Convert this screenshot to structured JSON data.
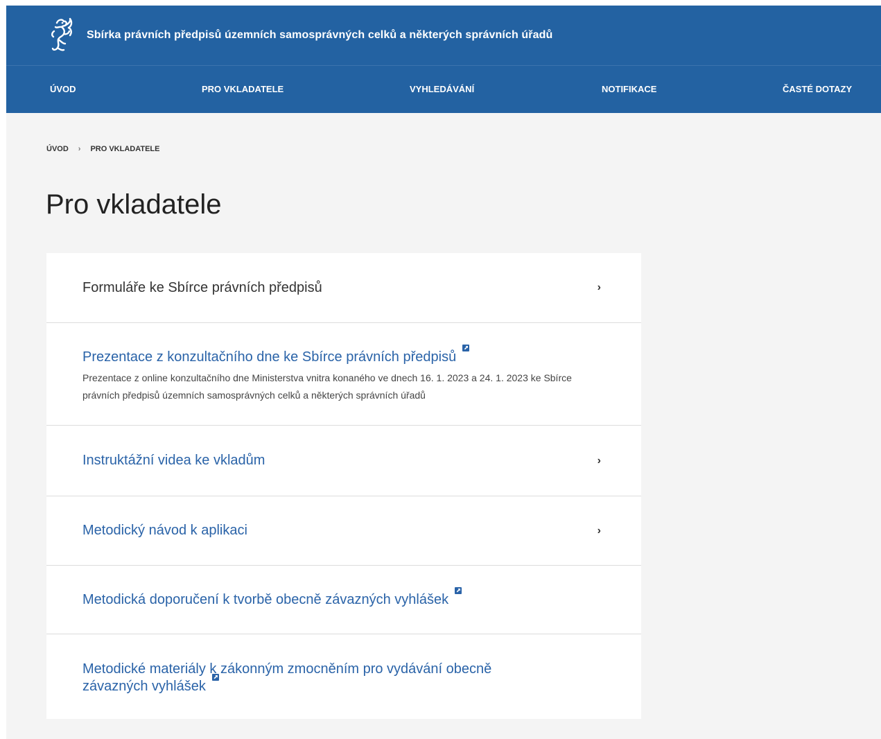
{
  "header": {
    "title": "Sbírka právních předpisů územních samosprávných celků a některých správních úřadů",
    "logo_icon": "czech-lion-icon"
  },
  "nav": {
    "items": [
      {
        "label": "ÚVOD"
      },
      {
        "label": "PRO VKLADATELE"
      },
      {
        "label": "VYHLEDÁVÁNÍ"
      },
      {
        "label": "NOTIFIKACE"
      },
      {
        "label": "ČASTÉ DOTAZY"
      }
    ]
  },
  "breadcrumb": {
    "home": "ÚVOD",
    "separator": "›",
    "current": "PRO VKLADATELE"
  },
  "page": {
    "title": "Pro vkladatele"
  },
  "list": {
    "items": [
      {
        "title": "Formuláře ke Sbírce právních předpisů",
        "chevron": "›"
      },
      {
        "title": "Prezentace z konzultačního dne ke Sbírce právních předpisů",
        "description": "Prezentace z online konzultačního dne Ministerstva vnitra konaného ve dnech 16. 1. 2023 a 24. 1. 2023 ke Sbírce právních předpisů územních samosprávných celků a některých správních úřadů"
      },
      {
        "title": "Instruktážní videa ke vkladům",
        "chevron": "›"
      },
      {
        "title": "Metodický návod k aplikaci",
        "chevron": "›"
      },
      {
        "title": "Metodická doporučení k tvorbě obecně závazných vyhlášek"
      },
      {
        "title": "Metodické materiály k zákonným zmocněním pro vydávání obecně závazných vyhlášek"
      }
    ]
  },
  "colors": {
    "header_bg": "#2362a2",
    "link": "#2a63a8",
    "page_bg": "#f4f4f4"
  }
}
